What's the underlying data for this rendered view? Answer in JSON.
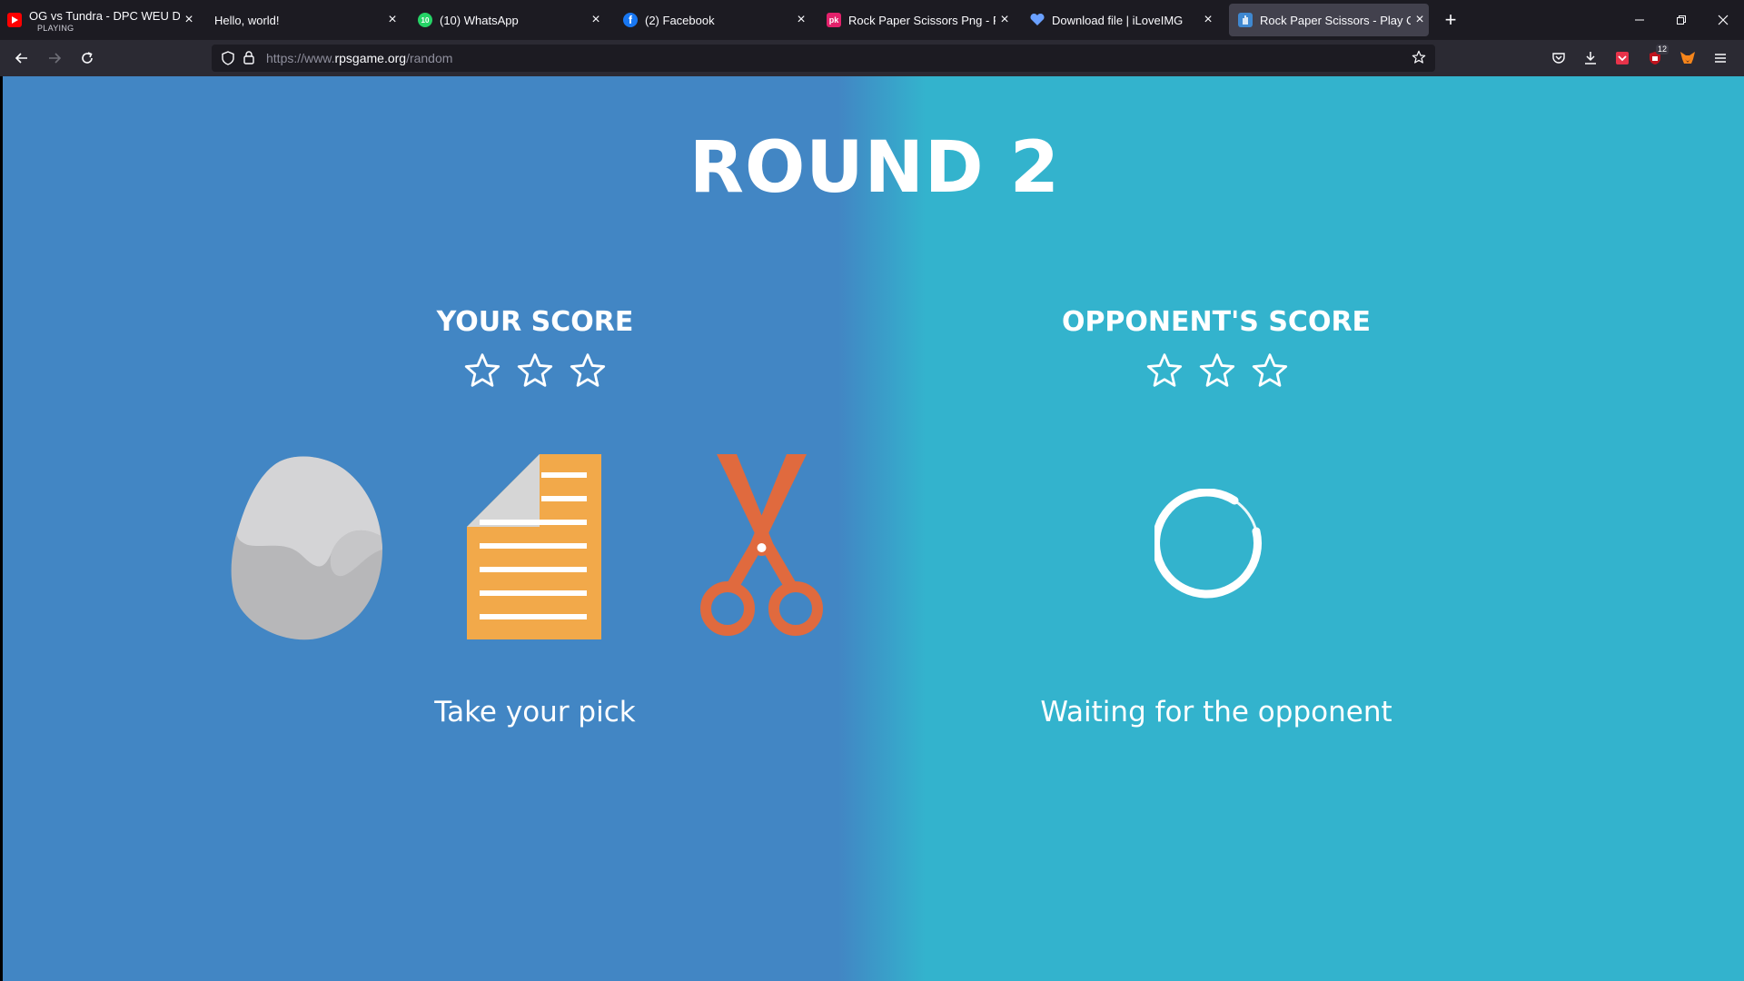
{
  "browser": {
    "tabs": [
      {
        "title": "OG vs Tundra - DPC WEU Divisio",
        "subtitle": "PLAYING",
        "icon": "youtube-icon"
      },
      {
        "title": "Hello, world!",
        "icon": "none"
      },
      {
        "title": "(10) WhatsApp",
        "icon": "whatsapp-icon"
      },
      {
        "title": "(2) Facebook",
        "icon": "facebook-icon"
      },
      {
        "title": "Rock Paper Scissors Png - Free",
        "icon": "pngkey-icon"
      },
      {
        "title": "Download file | iLoveIMG",
        "icon": "heart-icon"
      },
      {
        "title": "Rock Paper Scissors - Play Onlin",
        "icon": "rps-icon",
        "active": true
      }
    ],
    "url": {
      "prefix": "https://www.",
      "host": "rpsgame.org",
      "path": "/random"
    },
    "extension_badge": "12"
  },
  "game": {
    "round_title": "ROUND 2",
    "your_score_label": "YOUR SCORE",
    "opponent_score_label": "OPPONENT'S SCORE",
    "your_stars": 0,
    "opponent_stars": 0,
    "max_stars": 3,
    "choices": [
      "rock",
      "paper",
      "scissors"
    ],
    "your_status": "Take your pick",
    "opponent_status": "Waiting for the opponent"
  },
  "colors": {
    "left_bg": "#4286c4",
    "right_bg": "#33b3cd",
    "paper": "#f2a94a",
    "scissors": "#e06a3e",
    "rock": "#bcbcbe"
  }
}
